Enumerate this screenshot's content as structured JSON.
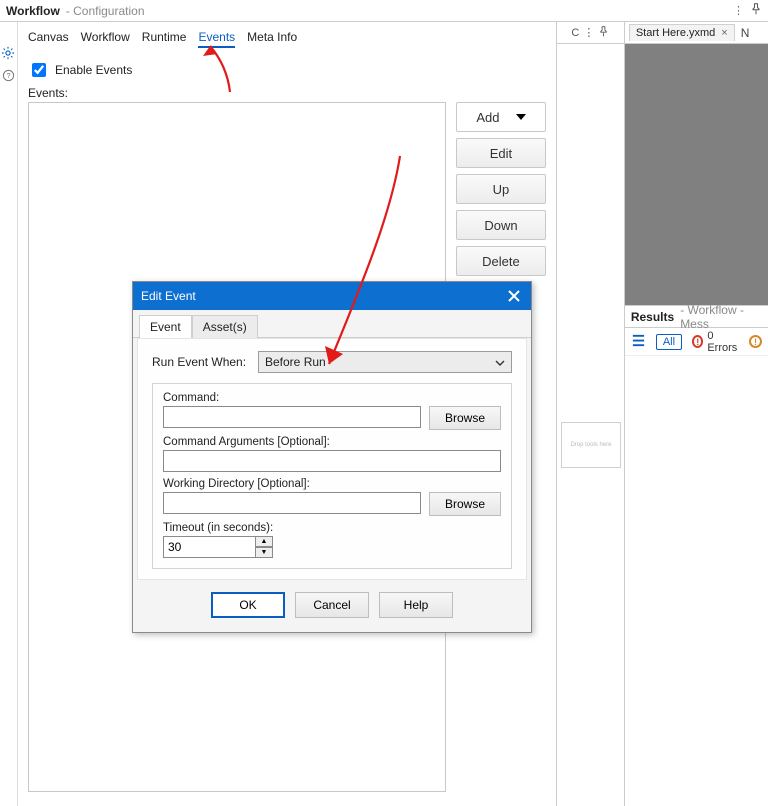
{
  "header": {
    "title": "Workflow",
    "subtitle": "- Configuration",
    "midbar_letter": "C"
  },
  "doc_tab": {
    "label": "Start Here.yxmd",
    "next_tab_letter": "N"
  },
  "tabs": {
    "canvas": "Canvas",
    "workflow": "Workflow",
    "runtime": "Runtime",
    "events": "Events",
    "meta": "Meta Info"
  },
  "config": {
    "enable_events": "Enable Events",
    "events_label": "Events:",
    "buttons": {
      "add": "Add",
      "edit": "Edit",
      "up": "Up",
      "down": "Down",
      "delete": "Delete"
    }
  },
  "modal": {
    "title": "Edit Event",
    "tab_event": "Event",
    "tab_assets": "Asset(s)",
    "run_when_label": "Run Event When:",
    "run_when_value": "Before Run",
    "cmd_label": "Command:",
    "cmd_value": "",
    "browse": "Browse",
    "cmd_args_label": "Command Arguments [Optional]:",
    "cmd_args_value": "",
    "wd_label": "Working Directory [Optional]:",
    "wd_value": "",
    "timeout_label": "Timeout (in seconds):",
    "timeout_value": "30",
    "ok": "OK",
    "cancel": "Cancel",
    "help": "Help"
  },
  "canvas_thumb": "Drop tools here",
  "results": {
    "title": "Results",
    "subtitle": "- Workflow - Mess",
    "all": "All",
    "errors": "0 Errors"
  }
}
